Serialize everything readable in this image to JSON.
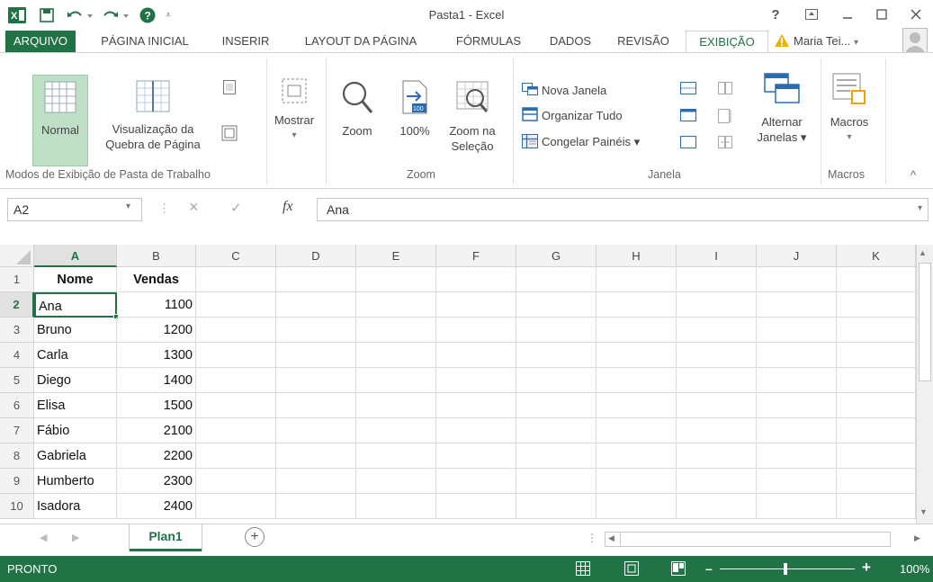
{
  "window": {
    "title": "Pasta1 - Excel",
    "help": "?",
    "user_name": "Maria Tei...",
    "warning_icon": "warning-icon",
    "colors": {
      "brand_green": "#217346",
      "ribbon_border": "#d4d4d4"
    }
  },
  "tabs": [
    "ARQUIVO",
    "PÁGINA INICIAL",
    "INSERIR",
    "LAYOUT DA PÁGINA",
    "FÓRMULAS",
    "DADOS",
    "REVISÃO",
    "EXIBIÇÃO"
  ],
  "active_tab": "EXIBIÇÃO",
  "ribbon": {
    "views": {
      "normal": "Normal",
      "page_break_line1": "Visualização da",
      "page_break_line2": "Quebra de Página",
      "group_label": "Modos de Exibição de Pasta de Trabalho"
    },
    "show": {
      "label": "Mostrar",
      "arrow": "▾"
    },
    "zoom": {
      "zoom_label": "Zoom",
      "hundred_label": "100%",
      "hundred_icon_text": "100",
      "selection_line1": "Zoom na",
      "selection_line2": "Seleção",
      "group_label": "Zoom"
    },
    "window": {
      "new_window": "Nova Janela",
      "arrange_all": "Organizar Tudo",
      "freeze_panes": "Congelar Painéis ▾",
      "switch_line1": "Alternar",
      "switch_line2": "Janelas ▾",
      "group_label": "Janela"
    },
    "macros": {
      "label": "Macros",
      "arrow": "▾",
      "group_label": "Macros"
    },
    "collapse": "^"
  },
  "formula_bar": {
    "name_box": "A2",
    "cancel": "×",
    "enter": "✓",
    "fx": "fx",
    "content": "Ana"
  },
  "sheet": {
    "columns": [
      "A",
      "B",
      "C",
      "D",
      "E",
      "F",
      "G",
      "H",
      "I",
      "J",
      "K"
    ],
    "rows": [
      "1",
      "2",
      "3",
      "4",
      "5",
      "6",
      "7",
      "8",
      "9",
      "10"
    ],
    "data": [
      [
        "Nome",
        "Vendas"
      ],
      [
        "Ana",
        "1100"
      ],
      [
        "Bruno",
        "1200"
      ],
      [
        "Carla",
        "1300"
      ],
      [
        "Diego",
        "1400"
      ],
      [
        "Elisa",
        "1500"
      ],
      [
        "Fábio",
        "2100"
      ],
      [
        "Gabriela",
        "2200"
      ],
      [
        "Humberto",
        "2300"
      ],
      [
        "Isadora",
        "2400"
      ]
    ],
    "active_cell": "A2"
  },
  "sheet_tabs": {
    "sheets": [
      "Plan1"
    ],
    "add": "+"
  },
  "status": {
    "text": "PRONTO",
    "zoom": "100%"
  }
}
